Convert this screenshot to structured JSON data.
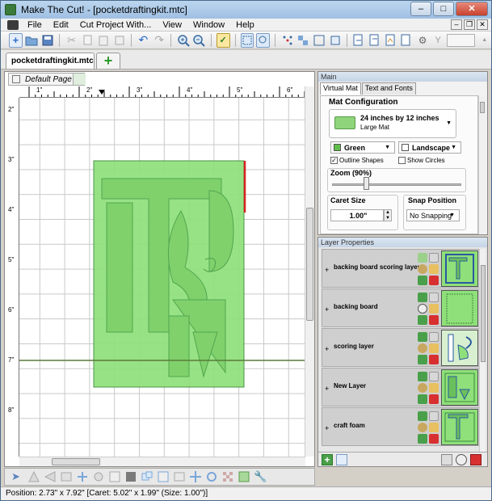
{
  "window": {
    "title": "Make The Cut! - [pocketdraftingkit.mtc]",
    "controls": {
      "minimize": "–",
      "maximize": "□",
      "close": "✕"
    }
  },
  "menu": {
    "items": [
      "File",
      "Edit",
      "Cut Project With...",
      "View",
      "Window",
      "Help"
    ]
  },
  "toolbar": {
    "zoom_value": "",
    "y_label": "Y"
  },
  "document": {
    "tab_label": "pocketdraftingkit.mtc",
    "add_tab": "+"
  },
  "canvas": {
    "page_tab": "Default Page",
    "ruler_top": [
      "1\"",
      "2\"",
      "3\"",
      "4\"",
      "5\"",
      "6\""
    ],
    "ruler_left": [
      "2\"",
      "3\"",
      "4\"",
      "5\"",
      "6\"",
      "7\"",
      "8\""
    ]
  },
  "main_panel": {
    "header": "Main",
    "tabs": [
      "Virtual Mat",
      "Text and Fonts"
    ],
    "mat_config_title": "Mat Configuration",
    "mat_name": "24 inches by 12 inches",
    "mat_size": "Large Mat",
    "mat_color": "Green",
    "orientation": "Landscape",
    "outline_shapes": "Outline Shapes",
    "show_circles": "Show Circles",
    "zoom_label": "Zoom (90%)",
    "zoom_percent": 90,
    "caret_size_label": "Caret Size",
    "caret_size_value": "1.00\"",
    "snap_position_label": "Snap Position",
    "snap_value": "No Snapping",
    "colors": {
      "mat_green": "#8fd47a",
      "swatch_green": "#5fbf4a"
    }
  },
  "layers_panel": {
    "header": "Layer Properties",
    "layers": [
      {
        "name": "backing board scoring layer"
      },
      {
        "name": "backing board"
      },
      {
        "name": "scoring layer"
      },
      {
        "name": "New Layer"
      },
      {
        "name": "craft foam"
      }
    ]
  },
  "status": {
    "text": "Position: 2.73\" x 7.92\" [Caret: 5.02\" x 1.99\" (Size: 1.00\")]"
  }
}
